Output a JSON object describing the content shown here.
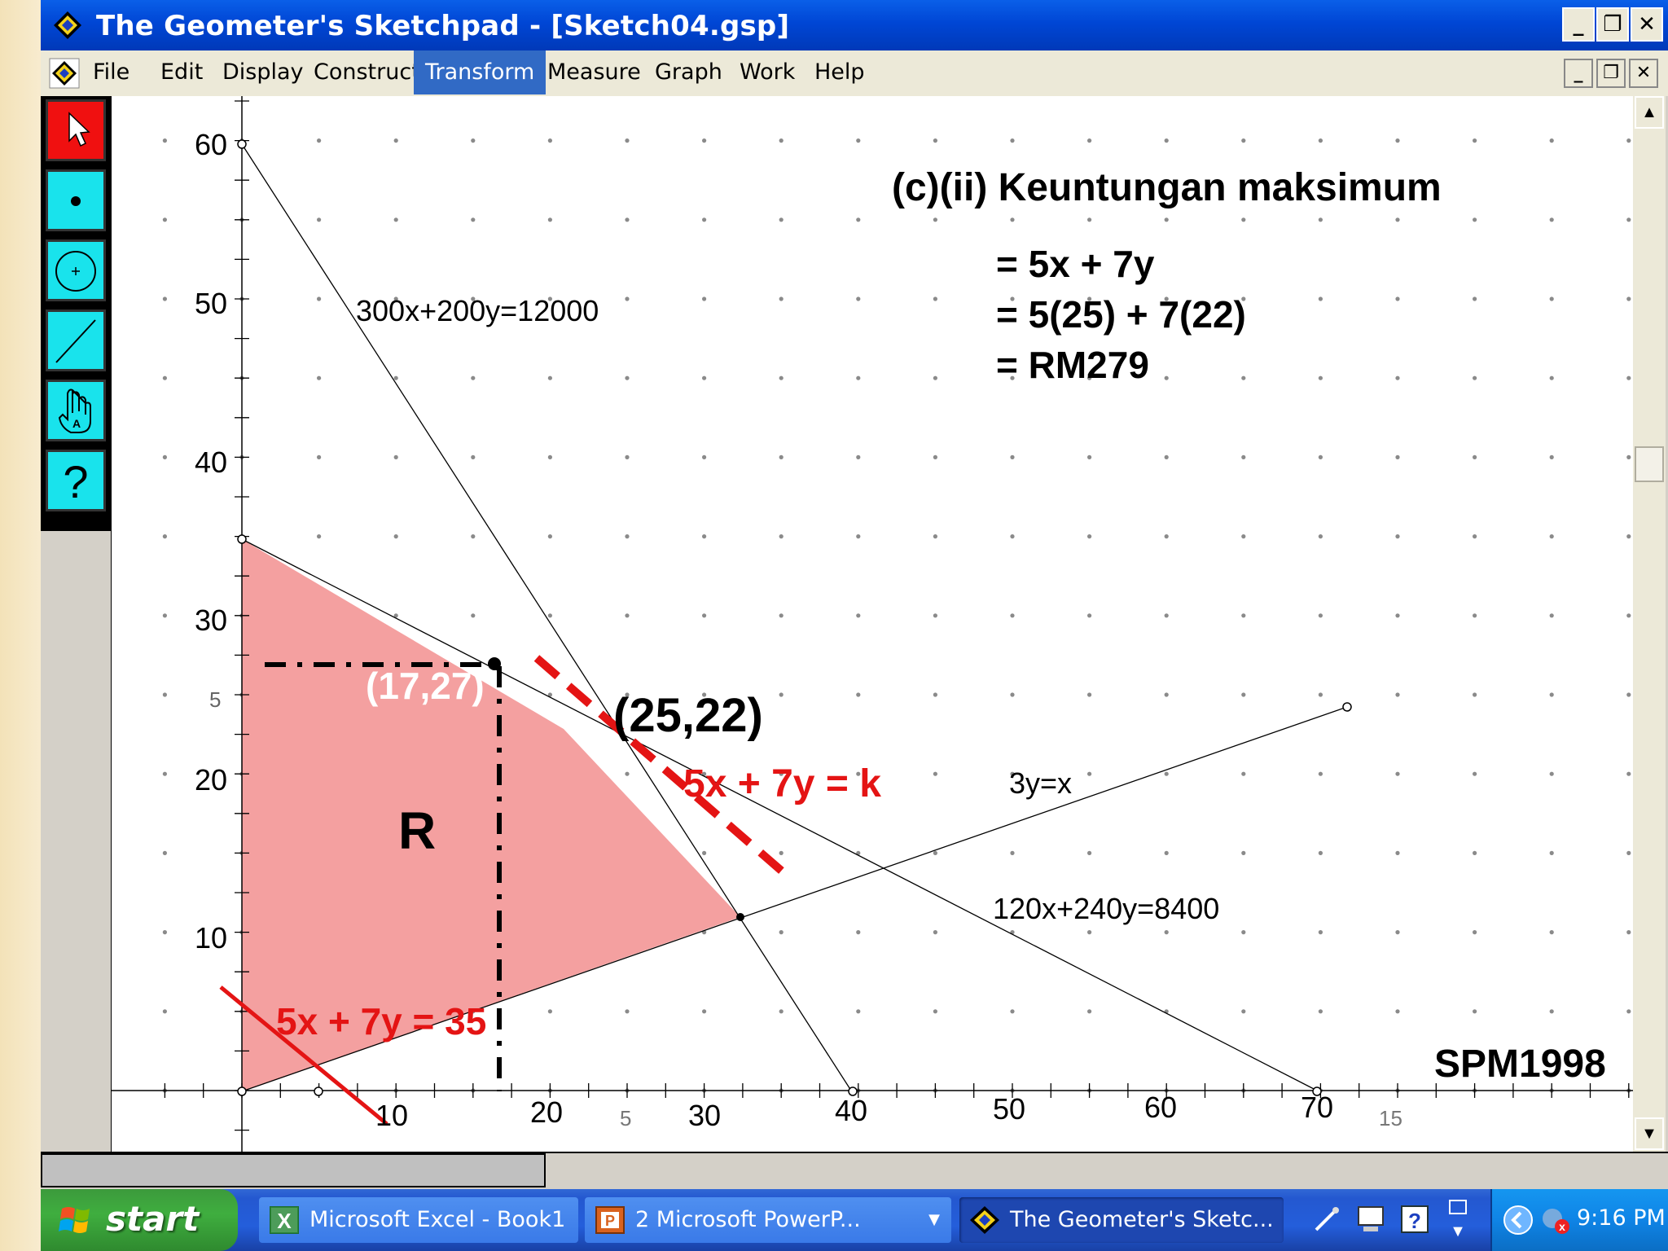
{
  "window": {
    "title": "The Geometer's Sketchpad - [Sketch04.gsp]"
  },
  "menu": {
    "items": [
      "File",
      "Edit",
      "Display",
      "Construct",
      "Transform",
      "Measure",
      "Graph",
      "Work",
      "Help"
    ],
    "active": "Transform"
  },
  "toolbox": {
    "tools": [
      "selection-arrow-tool",
      "point-tool",
      "compass-tool",
      "straightedge-tool",
      "text-tool",
      "help-tool"
    ],
    "help_glyph": "?"
  },
  "sketch": {
    "y_axis_ticks": [
      "60",
      "50",
      "40",
      "30",
      "20",
      "10"
    ],
    "y_axis_minor_label": "5",
    "x_axis_ticks": [
      "10",
      "20",
      "30",
      "40",
      "50",
      "60",
      "70"
    ],
    "x_axis_minor_labels": [
      "5",
      "15"
    ],
    "lines": {
      "line1_label": "300x+200y=12000",
      "line2_label": "120x+240y=8400",
      "line3_label": "3y=x"
    },
    "region_label": "R",
    "point_a": "(17,27)",
    "point_b": "(25,22)",
    "objective_line": "5x + 7y = k",
    "objective_initial": "5x + 7y = 35",
    "heading": "(c)(ii) Keuntungan maksimum",
    "work_lines": [
      "= 5x + 7y",
      "= 5(25) + 7(22)",
      "= RM279"
    ],
    "source": "SPM1998",
    "colors": {
      "region_fill": "#f4a0a0",
      "objective_red": "#e41414",
      "point_label_white": "#ffffff"
    }
  },
  "taskbar": {
    "start_label": "start",
    "tasks": [
      "Microsoft Excel - Book1",
      "2 Microsoft PowerP...",
      "The Geometer's Sketc..."
    ],
    "task_badge": "2",
    "clock": "9:16 PM"
  }
}
